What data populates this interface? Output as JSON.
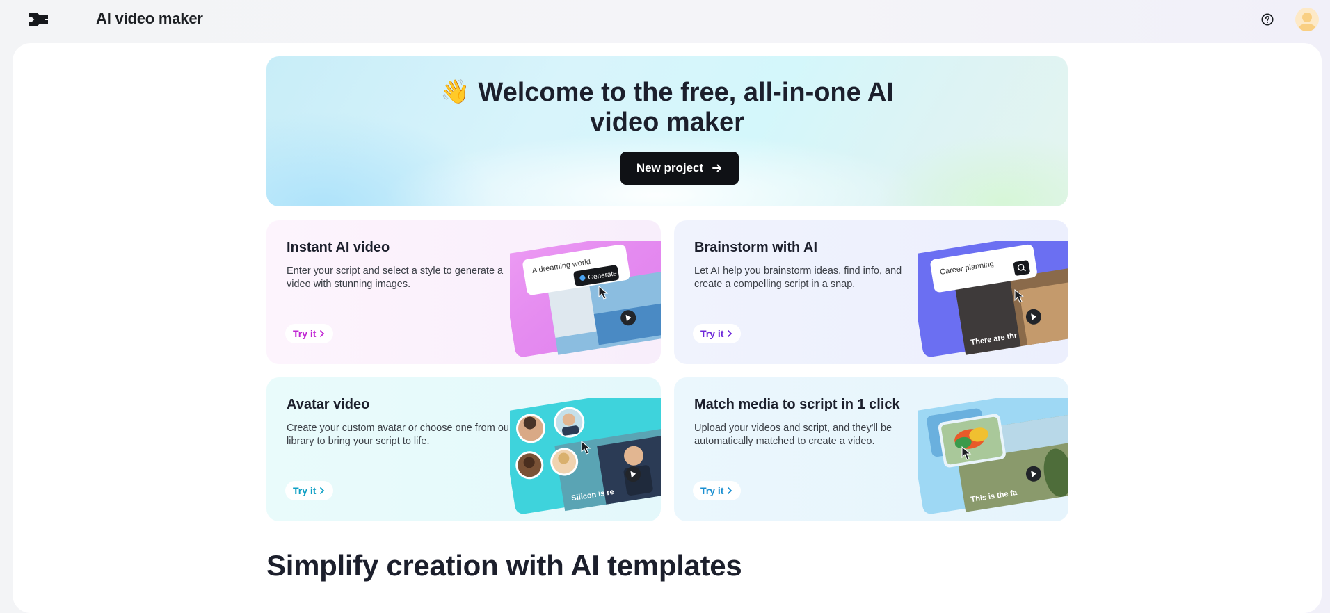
{
  "app": {
    "title": "AI video maker"
  },
  "hero": {
    "emoji": "👋",
    "title_line1": "Welcome to the free, all-in-one AI",
    "title_line2": "video maker",
    "button_label": "New project"
  },
  "cards": [
    {
      "title": "Instant AI video",
      "description": "Enter your script and select a style to generate a video with stunning images.",
      "cta": "Try it",
      "art": {
        "input_text": "A dreaming world",
        "button_text": "Generate"
      }
    },
    {
      "title": "Brainstorm with AI",
      "description": "Let AI help you brainstorm ideas, find info, and create a compelling script in a snap.",
      "cta": "Try it",
      "art": {
        "input_text": "Career planning",
        "caption": "There are thr"
      }
    },
    {
      "title": "Avatar video",
      "description": "Create your custom avatar or choose one from our library to bring your script to life.",
      "cta": "Try it",
      "art": {
        "caption": "Silicon is re"
      }
    },
    {
      "title": "Match media to script in 1 click",
      "description": "Upload your videos and script, and they'll be automatically matched to create a video.",
      "cta": "Try it",
      "art": {
        "caption": "This is the fa"
      }
    }
  ],
  "section": {
    "title": "Simplify creation with AI templates"
  },
  "icons": {
    "logo": "capcut-logo-icon",
    "help": "help-circle-icon",
    "arrow": "arrow-right-icon",
    "chevron": "chevron-right-icon",
    "play": "play-icon"
  },
  "colors": {
    "primary_button": "#0f1115",
    "cta_instant": "#c026d3",
    "cta_brainstorm": "#6d28d9",
    "cta_avatar": "#0e9fc4",
    "cta_match": "#1a8fd1"
  }
}
